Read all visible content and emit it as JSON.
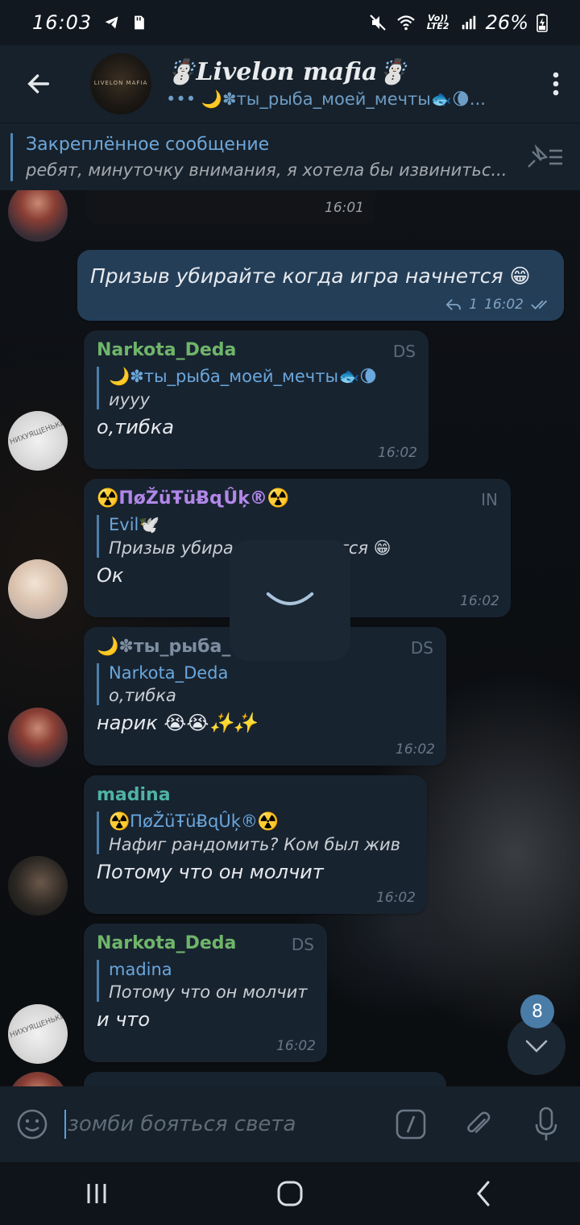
{
  "status_bar": {
    "time": "16:03",
    "network": "Vo)) LTE2",
    "battery": "26%"
  },
  "header": {
    "title": "☃️Livelon mafia☃️",
    "subtitle": "••• 🌙✽ты_рыба_моей_мечты🐟🌘...",
    "avatar_text": "LIVELON MAFIA"
  },
  "pinned": {
    "title": "Закреплённое сообщение",
    "text": "ребят, минуточку внимания, я хотела бы извинитьс..."
  },
  "messages": [
    {
      "time": "16:01"
    },
    {
      "text": "Призыв убирайте когда игра начнется 😁",
      "replies": "1",
      "time": "16:02"
    },
    {
      "sender": "Narkota_Deda",
      "role": "DS",
      "reply_name": "🌙✽ты_рыба_моей_мечты🐟🌘",
      "reply_text": "иууу",
      "text": "о,тибка",
      "time": "16:02",
      "avatar_label": "НИХУЯЩЕНЬКИ"
    },
    {
      "sender": "☢️ПøŽüŦüɃɋÛķ®☢️",
      "role": "IN",
      "reply_name": "Evil🕊️",
      "reply_text": "Призыв убира...тра начнется 😁",
      "text": "Ок",
      "time": "16:02"
    },
    {
      "sender": "🌙✽ты_рыба_...🐟🌘",
      "role": "DS",
      "reply_name": "Narkota_Deda",
      "reply_text": "о,тибка",
      "text": "нарик 😭😭✨✨",
      "time": "16:02"
    },
    {
      "sender": "madina",
      "reply_name": "☢️ПøŽüŦüɃɋÛķ®☢️",
      "reply_text": "Нафиг рандомить? Ком был жив",
      "text": "Потому что он молчит",
      "time": "16:02"
    },
    {
      "sender": "Narkota_Deda",
      "role": "DS",
      "reply_name": "madina",
      "reply_text": "Потому что он молчит",
      "text": "и что",
      "time": "16:02",
      "avatar_label": "НИХУЯЩЕНЬКИ"
    }
  ],
  "unread_count": "8",
  "input": {
    "value": "зомби бояться света"
  },
  "colors": {
    "accent": "#6ea7d8",
    "bubble_in": "#182330",
    "bubble_out": "#2b5278",
    "header_bg": "#17212b"
  },
  "icons": {
    "back": "arrow-left-icon",
    "menu": "more-vertical-icon",
    "pinned": "pinned-list-icon",
    "emoji": "emoji-icon",
    "commands": "slash-commands-icon",
    "attach": "paperclip-icon",
    "mic": "microphone-icon",
    "scroll": "chevron-down-icon"
  }
}
